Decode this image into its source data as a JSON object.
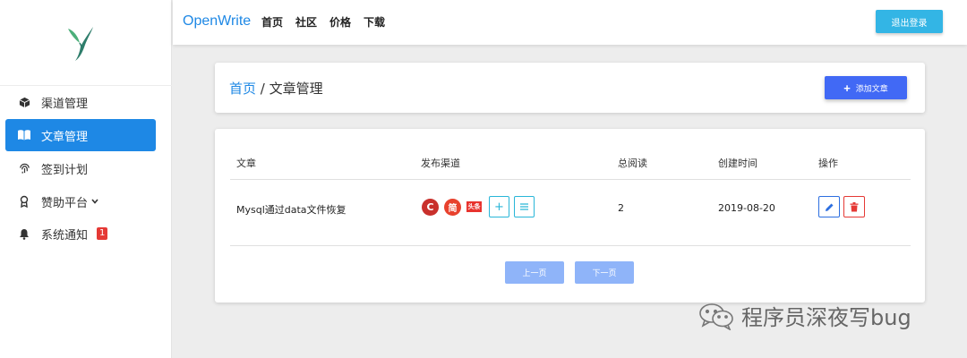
{
  "sidebar": {
    "items": [
      {
        "label": "渠道管理",
        "icon": "cube-icon"
      },
      {
        "label": "文章管理",
        "icon": "book-icon",
        "active": true
      },
      {
        "label": "签到计划",
        "icon": "fingerprint-icon"
      },
      {
        "label": "赞助平台",
        "icon": "award-icon",
        "has_dropdown": true
      },
      {
        "label": "系统通知",
        "icon": "bell-icon",
        "badge": "1"
      }
    ]
  },
  "header": {
    "brand": "OpenWrite",
    "nav": [
      "首页",
      "社区",
      "价格",
      "下载"
    ],
    "logout_label": "退出登录"
  },
  "breadcrumb": {
    "home": "首页",
    "separator": " / ",
    "current": "文章管理"
  },
  "toolbar": {
    "add_label": "添加文章"
  },
  "table": {
    "columns": [
      "文章",
      "发布渠道",
      "总阅读",
      "创建时间",
      "操作"
    ],
    "rows": [
      {
        "title": "Mysql通过data文件恢复",
        "channels": [
          "C",
          "简",
          "头条"
        ],
        "reads": "2",
        "created": "2019-08-20"
      }
    ]
  },
  "pagination": {
    "prev_label": "上一页",
    "next_label": "下一页"
  },
  "watermark": {
    "text": "程序员深夜写bug"
  },
  "colors": {
    "primary": "#1e88e5",
    "logout": "#33b5e5",
    "add_button": "#4169f5",
    "danger": "#e53935",
    "csdn": "#c9302c",
    "jianshu": "#e8412d",
    "toutiao": "#e8332e"
  }
}
